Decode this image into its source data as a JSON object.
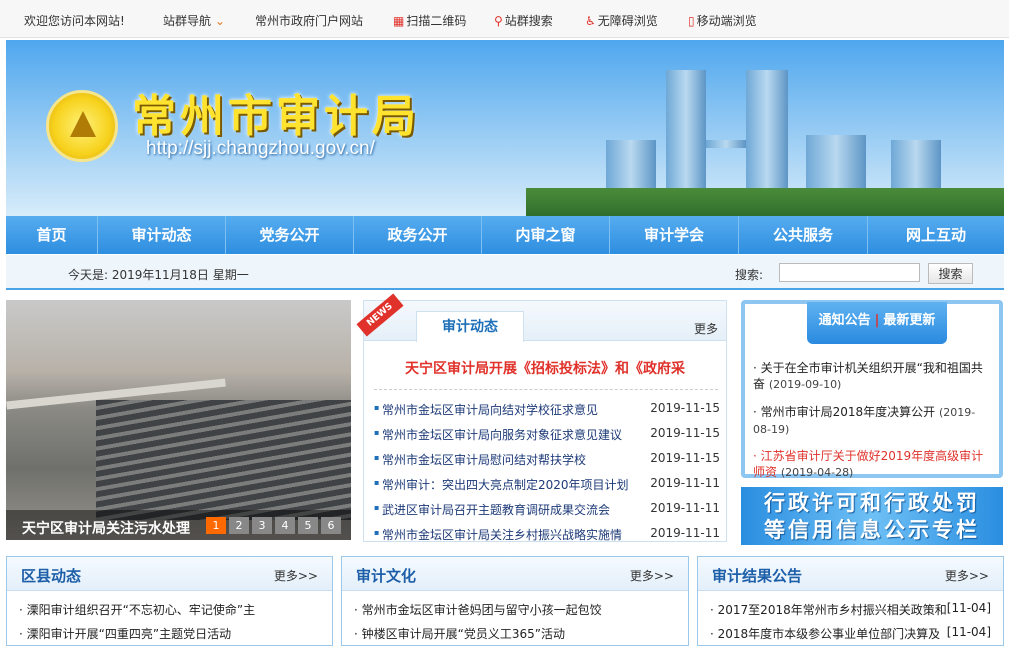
{
  "topbar": {
    "welcome": "欢迎您访问本网站!",
    "nav_group": "站群导航",
    "portal": "常州市政府门户网站",
    "qrcode": "扫描二维码",
    "search": "站群搜索",
    "accessible": "无障碍浏览",
    "mobile": "移动端浏览"
  },
  "banner": {
    "title": "常州市审计局",
    "url": "http://sjj.changzhou.gov.cn/"
  },
  "nav": {
    "items": [
      "首页",
      "审计动态",
      "党务公开",
      "政务公开",
      "内审之窗",
      "审计学会",
      "公共服务",
      "网上互动"
    ]
  },
  "datebar": {
    "date_label": "今天是: 2019年11月18日 星期一",
    "search_label": "搜索:",
    "search_value": "",
    "search_button": "搜索"
  },
  "slider": {
    "caption": "天宁区审计局关注污水处理",
    "pages": [
      "1",
      "2",
      "3",
      "4",
      "5",
      "6"
    ],
    "active_page": 1
  },
  "news": {
    "ribbon": "NEWS",
    "tab": "审计动态",
    "more": "更多",
    "headline": "天宁区审计局开展《招标投标法》和《政府采",
    "items": [
      {
        "title": "常州市金坛区审计局向结对学校征求意见",
        "date": "2019-11-15"
      },
      {
        "title": "常州市金坛区审计局向服务对象征求意见建议",
        "date": "2019-11-15"
      },
      {
        "title": "常州市金坛区审计局慰问结对帮扶学校",
        "date": "2019-11-15"
      },
      {
        "title": "常州审计：突出四大亮点制定2020年项目计划",
        "date": "2019-11-11"
      },
      {
        "title": "武进区审计局召开主题教育调研成果交流会",
        "date": "2019-11-11"
      },
      {
        "title": "常州市金坛区审计局关注乡村振兴战略实施情",
        "date": "2019-11-11"
      }
    ]
  },
  "notice": {
    "tab_notice": "通知公告",
    "separator": "|",
    "tab_latest": "最新更新",
    "items": [
      {
        "title": "关于在全市审计机关组织开展“我和祖国共奋",
        "date": "(2019-09-10)",
        "highlight": false
      },
      {
        "title": "常州市审计局2018年度决算公开",
        "date": "(2019-08-19)",
        "highlight": false
      },
      {
        "title": "江苏省审计厅关于做好2019年度高级审计师资",
        "date": "(2019-04-28)",
        "highlight": true
      }
    ]
  },
  "credit_banner": {
    "line1": "行政许可和行政处罚",
    "line2": "等信用信息公示专栏"
  },
  "panels": [
    {
      "title": "区县动态",
      "more": "更多>>",
      "items": [
        {
          "title": "溧阳审计组织召开“不忘初心、牢记使命”主",
          "date": ""
        },
        {
          "title": "溧阳审计开展“四重四亮”主题党日活动",
          "date": ""
        }
      ]
    },
    {
      "title": "审计文化",
      "more": "更多>>",
      "items": [
        {
          "title": "常州市金坛区审计爸妈团与留守小孩一起包饺",
          "date": ""
        },
        {
          "title": "钟楼区审计局开展“党员义工365”活动",
          "date": ""
        }
      ]
    },
    {
      "title": "审计结果公告",
      "more": "更多>>",
      "items": [
        {
          "title": "2017至2018年常州市乡村振兴相关政策和",
          "date": "[11-04]"
        },
        {
          "title": "2018年度市本级参公事业单位部门决算及",
          "date": "[11-04]"
        }
      ]
    }
  ],
  "colors": {
    "accent": "#2e8ee0",
    "headline_red": "#e0322b",
    "nav_text": "#ffffff"
  }
}
